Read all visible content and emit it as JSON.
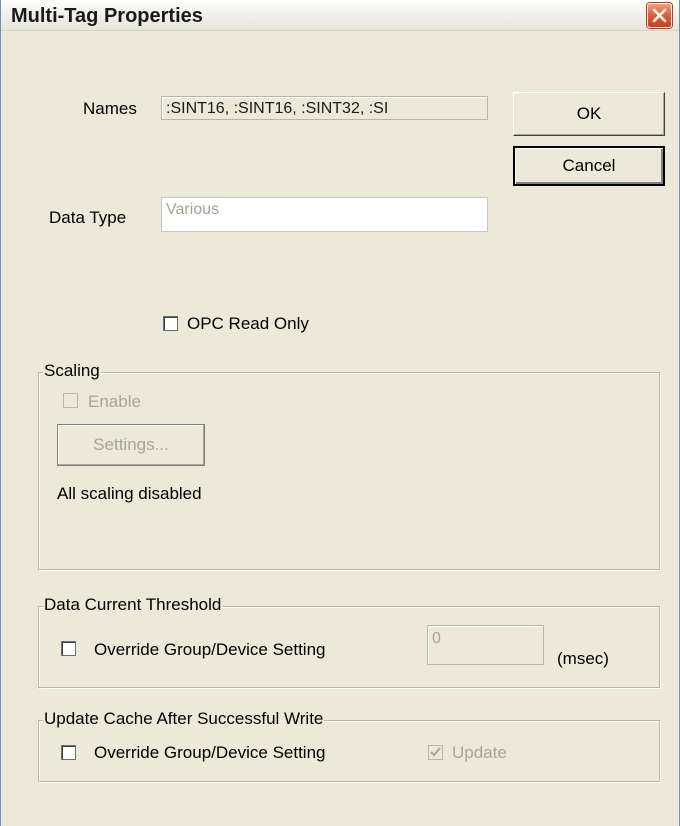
{
  "dialog": {
    "title": "Multi-Tag Properties"
  },
  "fields": {
    "names_label": "Names",
    "names_value": ":SINT16, :SINT16, :SINT32, :SI",
    "data_type_label": "Data Type",
    "data_type_value": "Various",
    "opc_read_only_label": "OPC Read Only",
    "opc_read_only_checked": false
  },
  "buttons": {
    "ok_label": "OK",
    "cancel_label": "Cancel"
  },
  "scaling": {
    "legend": "Scaling",
    "enable_label": "Enable",
    "enable_checked": false,
    "settings_label": "Settings...",
    "status_text": "All scaling disabled"
  },
  "data_current_threshold": {
    "legend": "Data Current Threshold",
    "override_label": "Override Group/Device Setting",
    "override_checked": false,
    "value": "0",
    "unit": "(msec)"
  },
  "update_cache": {
    "legend": "Update Cache After Successful Write",
    "override_label": "Override Group/Device Setting",
    "override_checked": false,
    "update_label": "Update",
    "update_checked": true
  },
  "colors": {
    "dialog_bg": "#ece9d8",
    "close_button": "#e35b35",
    "disabled_text": "#a7a593"
  }
}
